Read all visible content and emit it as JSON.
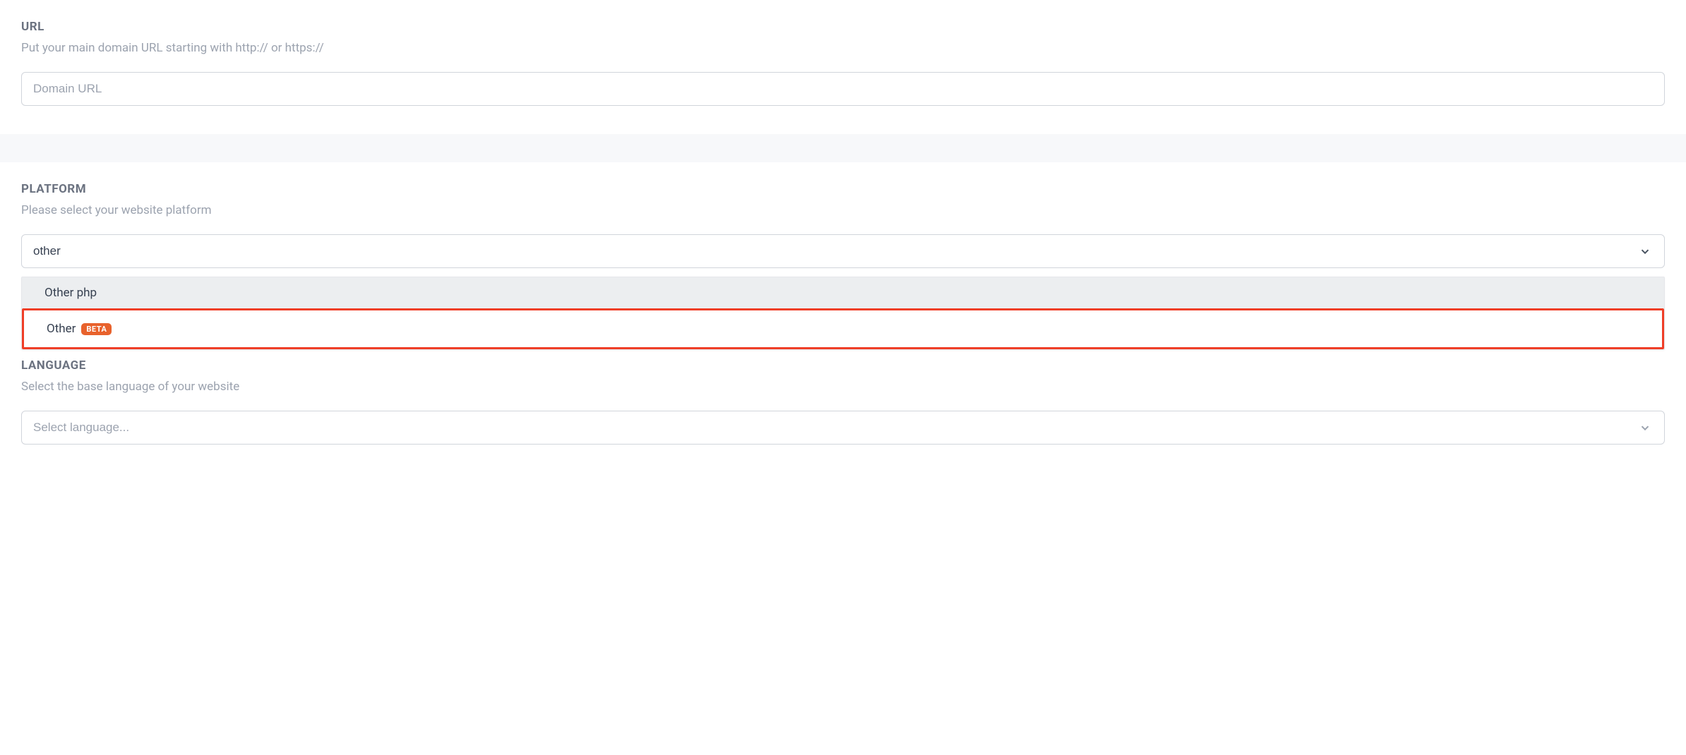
{
  "url_section": {
    "title": "URL",
    "subtitle": "Put your main domain URL starting with http:// or https://",
    "placeholder": "Domain URL",
    "value": ""
  },
  "platform_section": {
    "title": "PLATFORM",
    "subtitle": "Please select your website platform",
    "input_value": "other",
    "options": [
      {
        "label": "Other php",
        "badge": null,
        "highlighted": true,
        "boxed": false
      },
      {
        "label": "Other",
        "badge": "BETA",
        "highlighted": false,
        "boxed": true
      }
    ]
  },
  "language_section": {
    "title": "LANGUAGE",
    "subtitle": "Select the base language of your website",
    "placeholder": "Select language...",
    "value": ""
  },
  "colors": {
    "badge_bg": "#e8622c",
    "highlight_border": "#ef3e27"
  }
}
